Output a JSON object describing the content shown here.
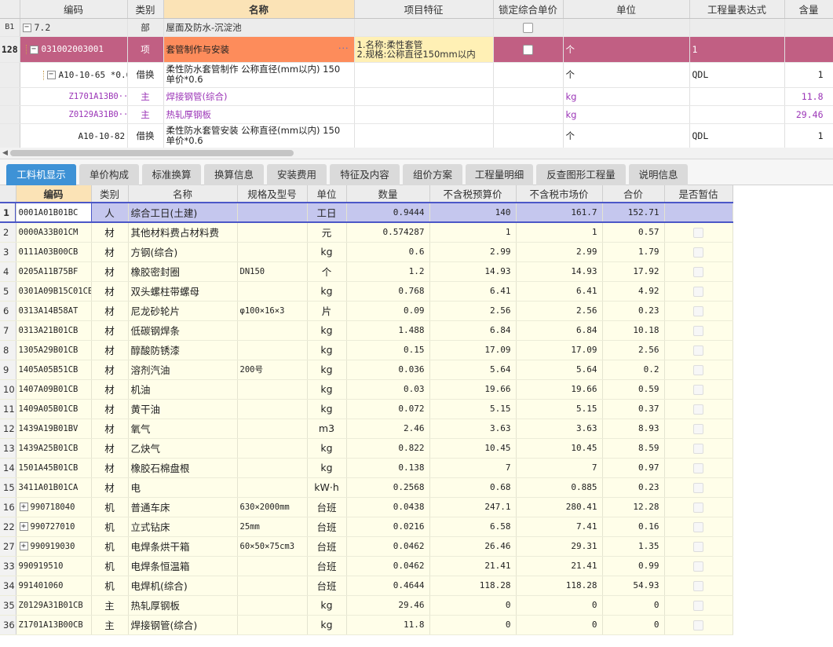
{
  "top_grid": {
    "headers": {
      "code": "编码",
      "type": "类别",
      "name": "名称",
      "feature": "项目特征",
      "lock": "锁定综合单价",
      "unit": "单位",
      "expr": "工程量表达式",
      "qty": "含量"
    },
    "rows": [
      {
        "rn": "B1",
        "code": "7.2",
        "type": "部",
        "name": "屋面及防水-沉淀池",
        "feature": "",
        "unit": "",
        "expr": "",
        "qty": "",
        "toggle": "−"
      },
      {
        "rn": "128",
        "code": "031002003001",
        "type": "项",
        "name": "套管制作与安装",
        "feature_lines": [
          "1.名称:柔性套管",
          "2.规格:公称直径150mm以内"
        ],
        "unit": "个",
        "expr": "1",
        "qty": "",
        "toggle": "−",
        "dots": "···"
      },
      {
        "rn": "",
        "code": "A10-10-65 *0.6",
        "type": "借换",
        "name": "柔性防水套管制作 公称直径(mm以内) 150 单价*0.6",
        "unit": "个",
        "expr": "QDL",
        "qty": "1",
        "toggle": "−"
      },
      {
        "rn": "",
        "code": "Z1701A13B0···",
        "type": "主",
        "name": "焊接钢管(综合)",
        "unit": "kg",
        "expr": "",
        "qty": "11.8"
      },
      {
        "rn": "",
        "code": "Z0129A31B0···",
        "type": "主",
        "name": "热轧厚钢板",
        "unit": "kg",
        "expr": "",
        "qty": "29.46"
      },
      {
        "rn": "",
        "code": "A10-10-82 *0.6",
        "type": "借换",
        "name": "柔性防水套管安装 公称直径(mm以内) 150 单价*0.6",
        "unit": "个",
        "expr": "QDL",
        "qty": "1"
      }
    ]
  },
  "tabs": [
    "工料机显示",
    "单价构成",
    "标准换算",
    "换算信息",
    "安装费用",
    "特征及内容",
    "组价方案",
    "工程量明细",
    "反查图形工程量",
    "说明信息"
  ],
  "bottom_grid": {
    "headers": {
      "code": "编码",
      "type": "类别",
      "name": "名称",
      "spec": "规格及型号",
      "unit": "单位",
      "qty": "数量",
      "pre": "不含税预算价",
      "mkt": "不含税市场价",
      "total": "合价",
      "temp": "是否暂估"
    },
    "rows": [
      {
        "rn": "1",
        "code": "0001A01B01BC",
        "type": "人",
        "name": "综合工日(土建)",
        "spec": "",
        "unit": "工日",
        "qty": "0.9444",
        "pre": "140",
        "mkt": "161.7",
        "total": "152.71"
      },
      {
        "rn": "2",
        "code": "0000A33B01CM",
        "type": "材",
        "name": "其他材料费占材料费",
        "spec": "",
        "unit": "元",
        "qty": "0.574287",
        "pre": "1",
        "mkt": "1",
        "total": "0.57"
      },
      {
        "rn": "3",
        "code": "0111A03B00CB",
        "type": "材",
        "name": "方钢(综合)",
        "spec": "",
        "unit": "kg",
        "qty": "0.6",
        "pre": "2.99",
        "mkt": "2.99",
        "total": "1.79"
      },
      {
        "rn": "4",
        "code": "0205A11B75BF",
        "type": "材",
        "name": "橡胶密封圈",
        "spec": "DN150",
        "unit": "个",
        "qty": "1.2",
        "pre": "14.93",
        "mkt": "14.93",
        "total": "17.92"
      },
      {
        "rn": "5",
        "code": "0301A09B15C01CB",
        "type": "材",
        "name": "双头螺柱带螺母",
        "spec": "",
        "unit": "kg",
        "qty": "0.768",
        "pre": "6.41",
        "mkt": "6.41",
        "total": "4.92"
      },
      {
        "rn": "6",
        "code": "0313A14B58AT",
        "type": "材",
        "name": "尼龙砂轮片",
        "spec": "φ100×16×3",
        "unit": "片",
        "qty": "0.09",
        "pre": "2.56",
        "mkt": "2.56",
        "total": "0.23"
      },
      {
        "rn": "7",
        "code": "0313A21B01CB",
        "type": "材",
        "name": "低碳钢焊条",
        "spec": "",
        "unit": "kg",
        "qty": "1.488",
        "pre": "6.84",
        "mkt": "6.84",
        "total": "10.18"
      },
      {
        "rn": "8",
        "code": "1305A29B01CB",
        "type": "材",
        "name": "醇酸防锈漆",
        "spec": "",
        "unit": "kg",
        "qty": "0.15",
        "pre": "17.09",
        "mkt": "17.09",
        "total": "2.56"
      },
      {
        "rn": "9",
        "code": "1405A05B51CB",
        "type": "材",
        "name": "溶剂汽油",
        "spec": "200号",
        "unit": "kg",
        "qty": "0.036",
        "pre": "5.64",
        "mkt": "5.64",
        "total": "0.2"
      },
      {
        "rn": "10",
        "code": "1407A09B01CB",
        "type": "材",
        "name": "机油",
        "spec": "",
        "unit": "kg",
        "qty": "0.03",
        "pre": "19.66",
        "mkt": "19.66",
        "total": "0.59"
      },
      {
        "rn": "11",
        "code": "1409A05B01CB",
        "type": "材",
        "name": "黄干油",
        "spec": "",
        "unit": "kg",
        "qty": "0.072",
        "pre": "5.15",
        "mkt": "5.15",
        "total": "0.37"
      },
      {
        "rn": "12",
        "code": "1439A19B01BV",
        "type": "材",
        "name": "氧气",
        "spec": "",
        "unit": "m3",
        "qty": "2.46",
        "pre": "3.63",
        "mkt": "3.63",
        "total": "8.93"
      },
      {
        "rn": "13",
        "code": "1439A25B01CB",
        "type": "材",
        "name": "乙炔气",
        "spec": "",
        "unit": "kg",
        "qty": "0.822",
        "pre": "10.45",
        "mkt": "10.45",
        "total": "8.59"
      },
      {
        "rn": "14",
        "code": "1501A45B01CB",
        "type": "材",
        "name": "橡胶石棉盘根",
        "spec": "",
        "unit": "kg",
        "qty": "0.138",
        "pre": "7",
        "mkt": "7",
        "total": "0.97"
      },
      {
        "rn": "15",
        "code": "3411A01B01CA",
        "type": "材",
        "name": "电",
        "spec": "",
        "unit": "kW·h",
        "qty": "0.2568",
        "pre": "0.68",
        "mkt": "0.885",
        "total": "0.23"
      },
      {
        "rn": "16",
        "code": "990718040",
        "type": "机",
        "name": "普通车床",
        "spec": "630×2000mm",
        "unit": "台班",
        "qty": "0.0438",
        "pre": "247.1",
        "mkt": "280.41",
        "total": "12.28",
        "plus": "+"
      },
      {
        "rn": "22",
        "code": "990727010",
        "type": "机",
        "name": "立式钻床",
        "spec": "25mm",
        "unit": "台班",
        "qty": "0.0216",
        "pre": "6.58",
        "mkt": "7.41",
        "total": "0.16",
        "plus": "+"
      },
      {
        "rn": "27",
        "code": "990919030",
        "type": "机",
        "name": "电焊条烘干箱",
        "spec": "60×50×75cm3",
        "unit": "台班",
        "qty": "0.0462",
        "pre": "26.46",
        "mkt": "29.31",
        "total": "1.35",
        "plus": "+"
      },
      {
        "rn": "33",
        "code": "990919510",
        "type": "机",
        "name": "电焊条恒温箱",
        "spec": "",
        "unit": "台班",
        "qty": "0.0462",
        "pre": "21.41",
        "mkt": "21.41",
        "total": "0.99"
      },
      {
        "rn": "34",
        "code": "991401060",
        "type": "机",
        "name": "电焊机(综合)",
        "spec": "",
        "unit": "台班",
        "qty": "0.4644",
        "pre": "118.28",
        "mkt": "118.28",
        "total": "54.93"
      },
      {
        "rn": "35",
        "code": "Z0129A31B01CB",
        "type": "主",
        "name": "热轧厚钢板",
        "spec": "",
        "unit": "kg",
        "qty": "29.46",
        "pre": "0",
        "mkt": "0",
        "total": "0"
      },
      {
        "rn": "36",
        "code": "Z1701A13B00CB",
        "type": "主",
        "name": "焊接钢管(综合)",
        "spec": "",
        "unit": "kg",
        "qty": "11.8",
        "pre": "0",
        "mkt": "0",
        "total": "0"
      }
    ]
  },
  "colors": {
    "selected_row": "#c15f83",
    "name_highlight": "#fd8c5b",
    "active_tab": "#3e92d6",
    "grid_bg": "#fffee9",
    "first_row": "#c5c7ee",
    "main_material": "#9b35b7"
  },
  "icons": {
    "collapse": "minus-box-icon",
    "expand": "plus-box-icon",
    "scroll_left": "arrow-left-icon"
  }
}
